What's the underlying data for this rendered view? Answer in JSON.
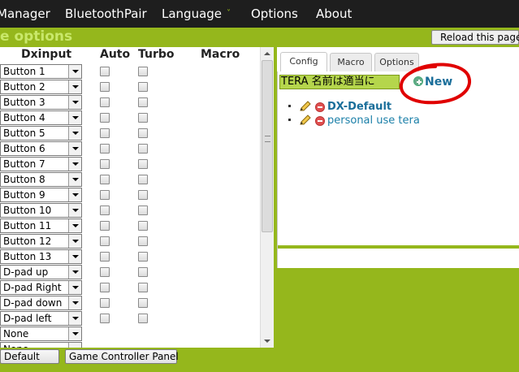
{
  "nav": {
    "items": [
      "Manager",
      "BluetoothPair",
      "Language",
      "Options",
      "About"
    ],
    "caret": "˅"
  },
  "title": "e options",
  "reload_label": "Reload this page",
  "grid": {
    "headers": {
      "dxinput": "Dxinput",
      "auto": "Auto",
      "turbo": "Turbo",
      "macro": "Macro"
    },
    "rows": [
      {
        "label": "Button 1",
        "checkboxes": true
      },
      {
        "label": "Button 2",
        "checkboxes": true
      },
      {
        "label": "Button 3",
        "checkboxes": true
      },
      {
        "label": "Button 4",
        "checkboxes": true
      },
      {
        "label": "Button 5",
        "checkboxes": true
      },
      {
        "label": "Button 6",
        "checkboxes": true
      },
      {
        "label": "Button 7",
        "checkboxes": true
      },
      {
        "label": "Button 8",
        "checkboxes": true
      },
      {
        "label": "Button 9",
        "checkboxes": true
      },
      {
        "label": "Button 10",
        "checkboxes": true
      },
      {
        "label": "Button 11",
        "checkboxes": true
      },
      {
        "label": "Button 12",
        "checkboxes": true
      },
      {
        "label": "Button 13",
        "checkboxes": true
      },
      {
        "label": "D-pad up",
        "checkboxes": true
      },
      {
        "label": "D-pad Right",
        "checkboxes": true
      },
      {
        "label": "D-pad down",
        "checkboxes": true
      },
      {
        "label": "D-pad left",
        "checkboxes": true
      },
      {
        "label": "None",
        "checkboxes": false
      },
      {
        "label": "None",
        "checkboxes": false
      }
    ]
  },
  "bottom": {
    "default_label": "Default",
    "gcp_label": "Game Controller Panel"
  },
  "right": {
    "tabs": [
      "Config",
      "Macro",
      "Options"
    ],
    "name_input_value": "TERA 名前は適当に",
    "new_label": "New",
    "profiles": [
      {
        "name": "DX-Default",
        "bold": true
      },
      {
        "name": "personal use tera",
        "bold": false
      }
    ]
  },
  "colors": {
    "accent": "#95b71c",
    "link": "#1a6e9a",
    "nav_bg": "#1e1e1e",
    "annotation": "#e00000"
  },
  "icons": [
    "edit-pencil-icon",
    "delete-minus-icon",
    "add-plus-icon",
    "dropdown-arrow-icon"
  ]
}
